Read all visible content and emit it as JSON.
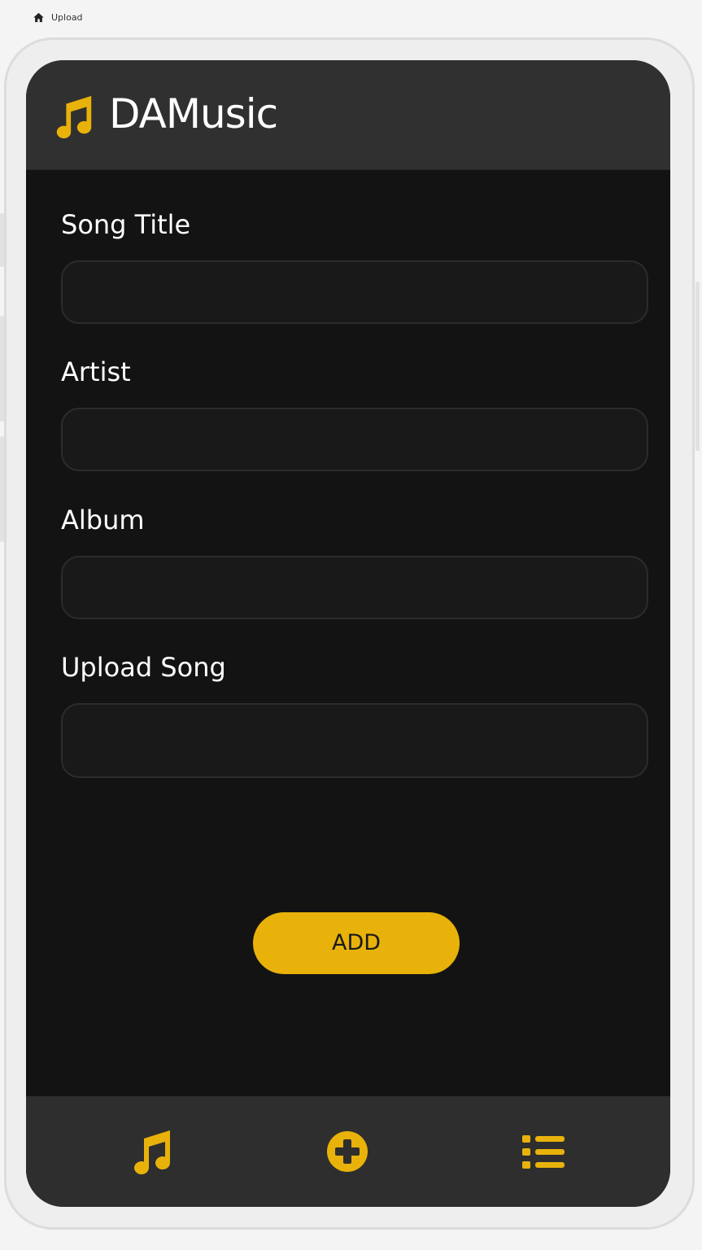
{
  "breadcrumb": {
    "icon": "home-icon",
    "label": "Upload"
  },
  "app": {
    "logo_icon": "music-note-icon",
    "title": "DAMusic"
  },
  "form": {
    "fields": [
      {
        "label": "Song Title",
        "value": "",
        "placeholder": ""
      },
      {
        "label": "Artist",
        "value": "",
        "placeholder": ""
      },
      {
        "label": "Album",
        "value": "",
        "placeholder": ""
      },
      {
        "label": "Upload Song",
        "value": "",
        "placeholder": ""
      }
    ],
    "submit_label": "ADD"
  },
  "bottom_nav": {
    "items": [
      {
        "icon": "music-note-icon"
      },
      {
        "icon": "plus-circle-icon"
      },
      {
        "icon": "list-icon"
      }
    ]
  },
  "colors": {
    "accent": "#e8b20a",
    "header_bg": "#303030",
    "screen_bg": "#131313",
    "input_bg": "#191919",
    "text": "#ffffff"
  }
}
